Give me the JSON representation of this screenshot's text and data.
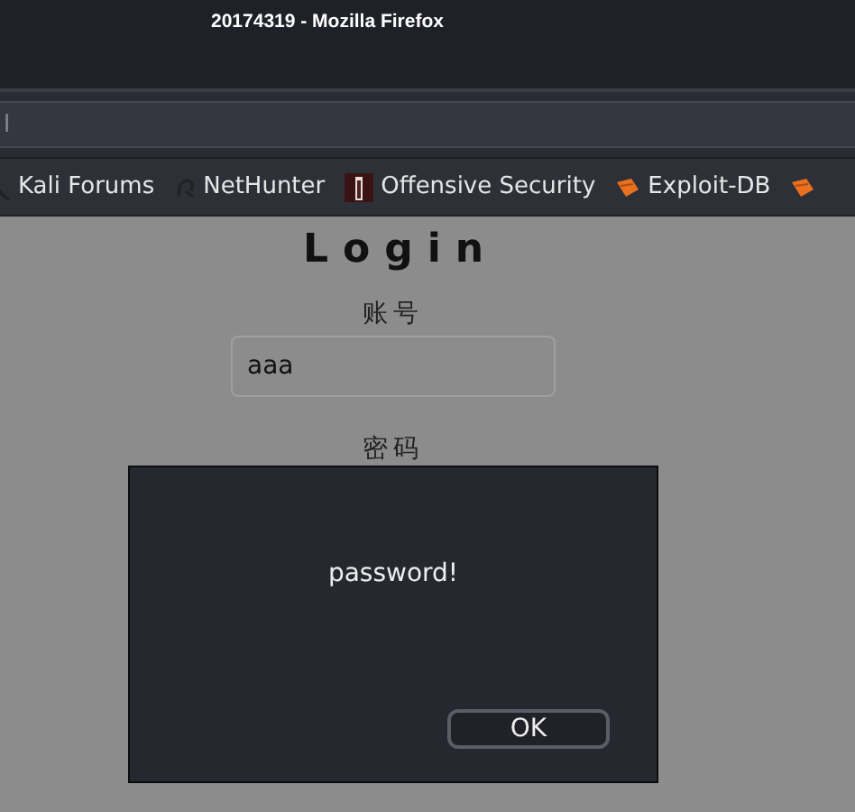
{
  "window": {
    "title": "20174319 - Mozilla Firefox"
  },
  "address_bar": {
    "value": "l"
  },
  "bookmarks": [
    {
      "label": "Kali Forums",
      "kind": "kali"
    },
    {
      "label": "NetHunter",
      "kind": "nethunter"
    },
    {
      "label": "Offensive Security",
      "kind": "offsec"
    },
    {
      "label": "Exploit-DB",
      "kind": "exploit"
    },
    {
      "kind": "exploit"
    }
  ],
  "page": {
    "heading": "Login",
    "username_label": "账号",
    "username_value": "aaa",
    "password_label": "密码"
  },
  "dialog": {
    "message": "password!",
    "button": "OK"
  }
}
